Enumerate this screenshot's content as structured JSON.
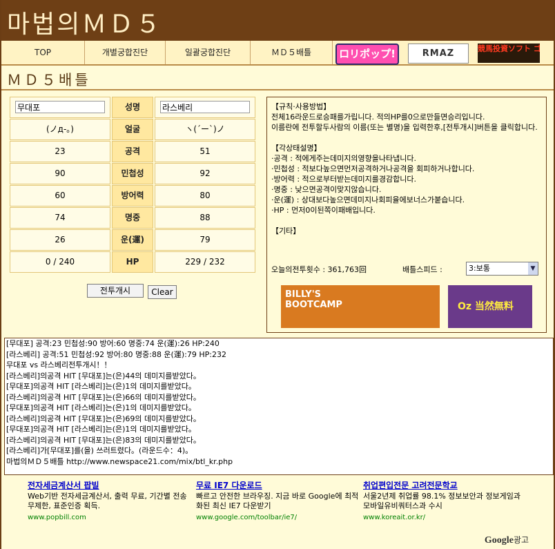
{
  "app": {
    "title": "마법의ＭＤ５"
  },
  "nav": {
    "items": [
      "TOP",
      "개별궁합진단",
      "일괄궁합진단",
      "ＭＤ５배틀"
    ],
    "banners": [
      "ロリポップ!",
      "RMAZ",
      "競馬投資ソフト ゴールドメーカー"
    ]
  },
  "page_title": "ＭＤ５배틀",
  "stats": {
    "left_name": "무대포",
    "right_name": "라스베리",
    "rows": [
      {
        "label": "성명",
        "left": "",
        "right": ""
      },
      {
        "label": "얼굴",
        "left": "(ノд-｡)",
        "right": "ヽ(´ー`)ノ"
      },
      {
        "label": "공격",
        "left": "23",
        "right": "51"
      },
      {
        "label": "민첩성",
        "left": "90",
        "right": "92"
      },
      {
        "label": "방어력",
        "left": "60",
        "right": "80"
      },
      {
        "label": "명중",
        "left": "74",
        "right": "88"
      },
      {
        "label": "운(運)",
        "left": "26",
        "right": "79"
      },
      {
        "label": "HP",
        "left": "0 / 240",
        "right": "229 / 232"
      }
    ],
    "start_button": "전투개시",
    "clear_button": "Clear"
  },
  "rules": {
    "text": "【규칙·사용방법】\n전체16라운드로승패를가립니다. 적의HP를0으로만들면승리입니다.\n이름란에 전투할두사람의 이름(또는 별명)을 입력한후,[전투개시]버튼을 클릭합니다.\n\n【각상태설명】\n·공격 : 적에게주는데미지의영향을나타냅니다.\n·민첩성 : 적보다높으면먼저공격하거나공격을 회피하거나합니다.\n·방어력 : 적으로부터받는데미지를경감합니다.\n·명중 : 낮으면공격이맞지않습니다.\n·운(運) : 상대보다높으면데미지나회피율에보너스가붙습니다.\n·HP : 먼저0이된쪽이패배입니다.\n\n【기타】",
    "count": "오늘의전투횟수 : 361,763回",
    "speed_label": "배틀스피드 :",
    "speed_value": "3:보통",
    "ad_left": "BILLY'S BOOTCAMP",
    "ad_right": "Oz 当然無料"
  },
  "log": [
    "[무대포] 공격:23 민첩성:90 방어:60 명중:74 운(運):26 HP:240",
    "[라스베리] 공격:51 민첩성:92 방어:80 명중:88 운(運):79 HP:232",
    "",
    "무대포 vs 라스베리전투개시！！",
    "[라스베리]의공격 HIT [무대포]는(은)44의 데미지를받았다。",
    "[무대포]의공격 HIT [라스베리]는(은)1의 데미지를받았다。",
    "[라스베리]의공격 HIT [무대포]는(은)66의 데미지를받았다。",
    "[무대포]의공격 HIT [라스베리]는(은)1의 데미지를받았다。",
    "[라스베리]의공격 HIT [무대포]는(은)69의 데미지를받았다。",
    "[무대포]의공격 HIT [라스베리]는(은)1의 데미지를받았다。",
    "[라스베리]의공격 HIT [무대포]는(은)83의 데미지를받았다。",
    "[라스베리]가[무대포]를(을) 쓰러트렸다。(라운드수：4)。",
    "마법의ＭＤ５배틀 http://www.newspace21.com/mix/btl_kr.php"
  ],
  "ads": [
    {
      "title": "전자세금계산서 팝빌",
      "desc": "Web기반 전자세금계산서, 출력 무료, 기간별 전송무제한, 표준인증 획득.",
      "url": "www.popbill.com"
    },
    {
      "title": "무료 IE7 다운로드",
      "desc": "빠르고 안전한 브라우징. 지금 바로 Google에 최적화된 최신 IE7 다운받기",
      "url": "www.google.com/toolbar/ie7/"
    },
    {
      "title": "취업편입전문 고려전문학교",
      "desc": "서울2년제 취업률 98.1% 정보보안과 정보게임과 모바일유비쿼터스과 수시",
      "url": "www.koreait.or.kr/"
    }
  ],
  "google_label": "Google",
  "google_suffix": "광고"
}
